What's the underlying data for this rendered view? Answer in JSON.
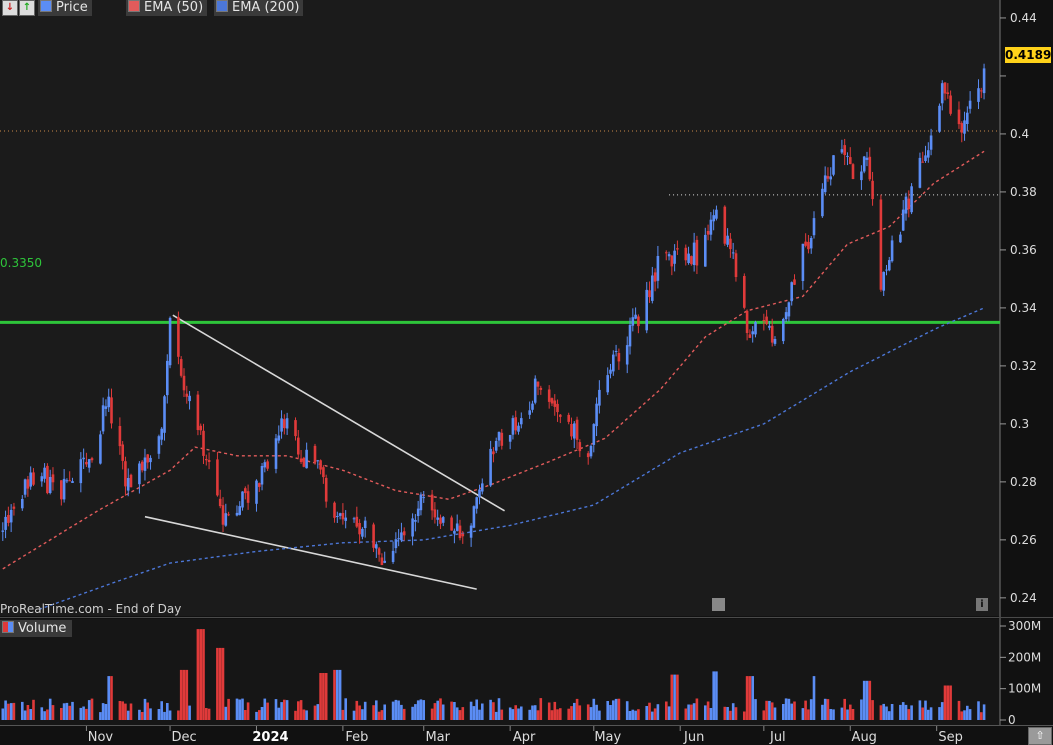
{
  "header": {
    "price_label": "Price",
    "ema50_label": "EMA (50)",
    "ema200_label": "EMA (200)",
    "volume_label": "Volume"
  },
  "watermark": "ProRealTime.com - End of Day",
  "colors": {
    "up": "#5b8df5",
    "down": "#e03a3a",
    "ema50": "#e25b5b",
    "ema200": "#4c77d8",
    "level": "#2ec43a",
    "background": "#111111",
    "axis_text": "#dddddd"
  },
  "chart_data": {
    "type": "candlestick",
    "current_price_label": "0.4189",
    "price_axis": {
      "ticks": [
        0.24,
        0.26,
        0.28,
        0.3,
        0.32,
        0.34,
        0.36,
        0.38,
        0.4,
        0.42,
        0.44
      ],
      "tick_labels": [
        "0.24",
        "0.26",
        "0.28",
        "0.3",
        "0.32",
        "0.34",
        "0.36",
        "0.38",
        "0.4",
        "",
        "0.44"
      ],
      "range": [
        0.2365,
        0.4455
      ]
    },
    "volume_axis": {
      "ticks": [
        0,
        100,
        200,
        300
      ],
      "tick_labels": [
        "0",
        "100M",
        "200M",
        "300M"
      ],
      "range": [
        0,
        300
      ]
    },
    "months": [
      "Nov",
      "Dec",
      "2024",
      "Feb",
      "Mar",
      "Apr",
      "May",
      "Jun",
      "Jul",
      "Aug",
      "Sep"
    ],
    "level_line": {
      "value": 0.335,
      "label": "0.3350"
    },
    "dotted_levels": [
      {
        "value": 0.401,
        "from": "Oct"
      },
      {
        "value": 0.379,
        "from": "Jun"
      }
    ],
    "trendlines": [
      {
        "from": [
          "2023-12-02",
          0.3375
        ],
        "to": [
          "2024-03-30",
          0.27
        ]
      },
      {
        "from": [
          "2023-11-22",
          0.268
        ],
        "to": [
          "2024-03-20",
          0.243
        ]
      }
    ],
    "price_path": [
      [
        "2023-10-02",
        0.262
      ],
      [
        "2023-10-08",
        0.275
      ],
      [
        "2023-10-15",
        0.283
      ],
      [
        "2023-10-22",
        0.276
      ],
      [
        "2023-10-29",
        0.285
      ],
      [
        "2023-11-05",
        0.292
      ],
      [
        "2023-11-08",
        0.31
      ],
      [
        "2023-11-15",
        0.28
      ],
      [
        "2023-11-22",
        0.286
      ],
      [
        "2023-11-28",
        0.299
      ],
      [
        "2023-12-01",
        0.333
      ],
      [
        "2023-12-08",
        0.307
      ],
      [
        "2023-12-15",
        0.285
      ],
      [
        "2023-12-20",
        0.265
      ],
      [
        "2023-12-28",
        0.275
      ],
      [
        "2024-01-05",
        0.284
      ],
      [
        "2024-01-12",
        0.305
      ],
      [
        "2024-01-16",
        0.29
      ],
      [
        "2024-01-22",
        0.286
      ],
      [
        "2024-01-30",
        0.268
      ],
      [
        "2024-02-08",
        0.265
      ],
      [
        "2024-02-15",
        0.255
      ],
      [
        "2024-02-22",
        0.262
      ],
      [
        "2024-03-01",
        0.276
      ],
      [
        "2024-03-08",
        0.268
      ],
      [
        "2024-03-14",
        0.261
      ],
      [
        "2024-03-20",
        0.272
      ],
      [
        "2024-03-25",
        0.292
      ],
      [
        "2024-04-03",
        0.3
      ],
      [
        "2024-04-12",
        0.315
      ],
      [
        "2024-04-20",
        0.305
      ],
      [
        "2024-04-28",
        0.288
      ],
      [
        "2024-05-04",
        0.312
      ],
      [
        "2024-05-10",
        0.325
      ],
      [
        "2024-05-17",
        0.336
      ],
      [
        "2024-05-24",
        0.355
      ],
      [
        "2024-06-01",
        0.36
      ],
      [
        "2024-06-08",
        0.358
      ],
      [
        "2024-06-14",
        0.374
      ],
      [
        "2024-06-20",
        0.358
      ],
      [
        "2024-06-26",
        0.33
      ],
      [
        "2024-07-01",
        0.333
      ],
      [
        "2024-07-06",
        0.328
      ],
      [
        "2024-07-12",
        0.35
      ],
      [
        "2024-07-20",
        0.372
      ],
      [
        "2024-07-27",
        0.396
      ],
      [
        "2024-08-03",
        0.385
      ],
      [
        "2024-08-07",
        0.393
      ],
      [
        "2024-08-10",
        0.366
      ],
      [
        "2024-08-12",
        0.35
      ],
      [
        "2024-08-20",
        0.372
      ],
      [
        "2024-08-28",
        0.393
      ],
      [
        "2024-09-03",
        0.414
      ],
      [
        "2024-09-10",
        0.402
      ],
      [
        "2024-09-15",
        0.413
      ],
      [
        "2024-09-18",
        0.419
      ]
    ],
    "ema50_path": [
      [
        "2023-10-02",
        0.25
      ],
      [
        "2023-11-05",
        0.27
      ],
      [
        "2023-12-01",
        0.284
      ],
      [
        "2023-12-10",
        0.292
      ],
      [
        "2023-12-25",
        0.289
      ],
      [
        "2024-01-12",
        0.289
      ],
      [
        "2024-02-01",
        0.284
      ],
      [
        "2024-02-20",
        0.277
      ],
      [
        "2024-03-10",
        0.274
      ],
      [
        "2024-03-25",
        0.279
      ],
      [
        "2024-04-15",
        0.287
      ],
      [
        "2024-05-05",
        0.295
      ],
      [
        "2024-05-25",
        0.312
      ],
      [
        "2024-06-10",
        0.33
      ],
      [
        "2024-06-25",
        0.339
      ],
      [
        "2024-07-15",
        0.344
      ],
      [
        "2024-07-31",
        0.362
      ],
      [
        "2024-08-15",
        0.368
      ],
      [
        "2024-08-31",
        0.383
      ],
      [
        "2024-09-18",
        0.394
      ]
    ],
    "ema200_path": [
      [
        "2023-10-15",
        0.236
      ],
      [
        "2023-11-10",
        0.245
      ],
      [
        "2023-12-01",
        0.252
      ],
      [
        "2024-01-01",
        0.256
      ],
      [
        "2024-02-01",
        0.259
      ],
      [
        "2024-03-01",
        0.26
      ],
      [
        "2024-04-01",
        0.265
      ],
      [
        "2024-05-01",
        0.272
      ],
      [
        "2024-06-01",
        0.29
      ],
      [
        "2024-07-01",
        0.3
      ],
      [
        "2024-08-01",
        0.318
      ],
      [
        "2024-09-01",
        0.333
      ],
      [
        "2024-09-18",
        0.34
      ]
    ],
    "volume_spikes": [
      [
        "2023-11-10",
        140
      ],
      [
        "2023-12-06",
        160
      ],
      [
        "2023-12-12",
        290
      ],
      [
        "2023-12-19",
        230
      ],
      [
        "2024-01-25",
        150
      ],
      [
        "2024-01-30",
        160
      ],
      [
        "2024-05-30",
        145
      ],
      [
        "2024-06-14",
        155
      ],
      [
        "2024-06-26",
        140
      ],
      [
        "2024-07-20",
        140
      ],
      [
        "2024-08-07",
        125
      ],
      [
        "2024-09-05",
        110
      ]
    ]
  }
}
